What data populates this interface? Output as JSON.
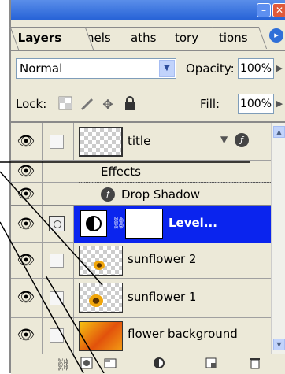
{
  "window": {
    "minimize_glyph": "–",
    "close_glyph": "✕"
  },
  "tabs": [
    {
      "label": "Layers",
      "active": true
    },
    {
      "label": "nels",
      "active": false
    },
    {
      "label": "aths",
      "active": false
    },
    {
      "label": "tory",
      "active": false
    },
    {
      "label": "tions",
      "active": false
    }
  ],
  "panel_menu_glyph": "▸",
  "blend": {
    "mode": "Normal",
    "opacity_label": "Opacity:",
    "opacity_value": "100%"
  },
  "lock": {
    "label": "Lock:",
    "fill_label": "Fill:",
    "fill_value": "100%"
  },
  "layers": [
    {
      "name": "title",
      "type": "text",
      "visible": true
    },
    {
      "name": "Effects",
      "type": "effects-header"
    },
    {
      "name": "Drop Shadow",
      "type": "effect"
    },
    {
      "name": "Level...",
      "type": "adjustment",
      "selected": true
    },
    {
      "name": "sunflower 2",
      "type": "image"
    },
    {
      "name": "sunflower 1",
      "type": "image"
    },
    {
      "name": "flower background",
      "type": "image"
    }
  ],
  "icons": {
    "eye": "eye-icon",
    "fx": "fx-icon",
    "chain": "chain-link-icon"
  },
  "colors": {
    "selection": "#0a24ee",
    "titlebar": "#2561d6"
  }
}
